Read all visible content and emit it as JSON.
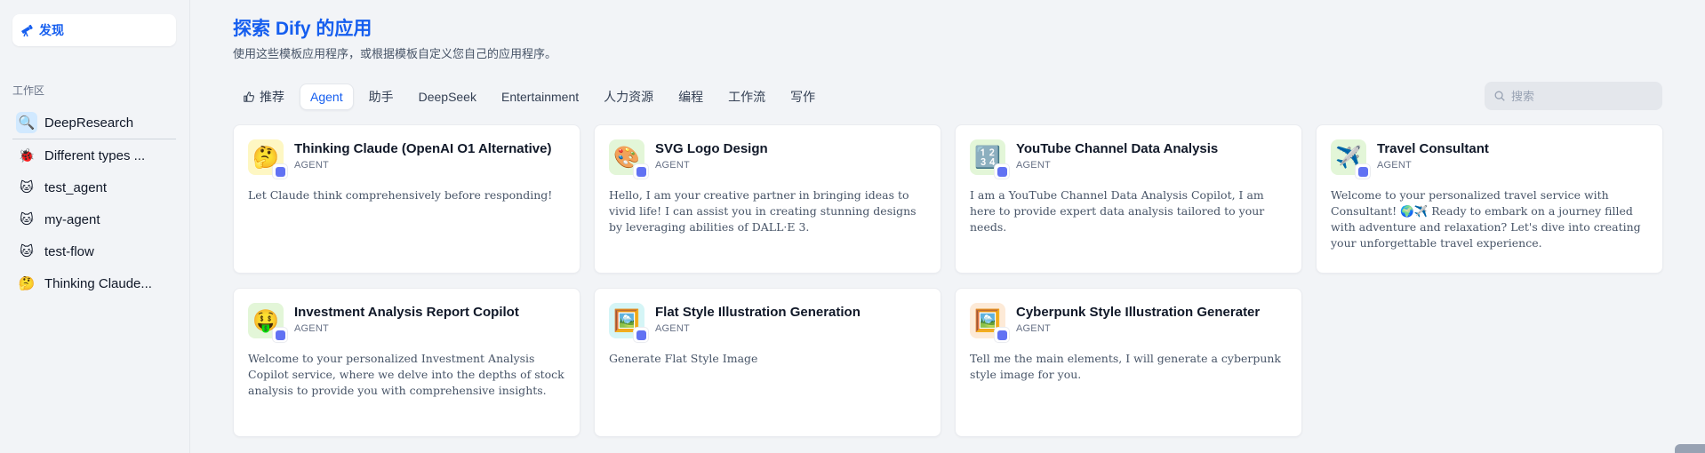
{
  "sidebar": {
    "discover_label": "发现",
    "workspace_label": "工作区",
    "items": [
      {
        "label": "DeepResearch",
        "icon": "🔍",
        "icon_bg": "#d1e9ff"
      },
      {
        "label": "Different types ...",
        "icon": "🐞",
        "icon_bg": "transparent"
      },
      {
        "label": "test_agent",
        "icon": "🐱",
        "icon_bg": "transparent"
      },
      {
        "label": "my-agent",
        "icon": "🐱",
        "icon_bg": "transparent"
      },
      {
        "label": "test-flow",
        "icon": "🐱",
        "icon_bg": "transparent"
      },
      {
        "label": "Thinking Claude...",
        "icon": "🤔",
        "icon_bg": "transparent"
      }
    ]
  },
  "header": {
    "title": "探索 Dify 的应用",
    "subtitle": "使用这些模板应用程序，或根据模板自定义您自己的应用程序。"
  },
  "tabs": [
    {
      "label": "推荐",
      "icon": "thumbs-up-icon"
    },
    {
      "label": "Agent",
      "active": true
    },
    {
      "label": "助手"
    },
    {
      "label": "DeepSeek"
    },
    {
      "label": "Entertainment"
    },
    {
      "label": "人力资源"
    },
    {
      "label": "编程"
    },
    {
      "label": "工作流"
    },
    {
      "label": "写作"
    }
  ],
  "search": {
    "placeholder": "搜索"
  },
  "cards": [
    {
      "title": "Thinking Claude (OpenAI O1 Alternative)",
      "type": "AGENT",
      "icon": "🤔",
      "icon_bg": "#fef7c3",
      "desc": "Let Claude think comprehensively before responding!"
    },
    {
      "title": "SVG Logo Design",
      "type": "AGENT",
      "icon": "🎨",
      "icon_bg": "#e3f6d8",
      "desc": "Hello, I am your creative partner in bringing ideas to vivid life! I can assist you in creating stunning designs by leveraging abilities of DALL·E 3."
    },
    {
      "title": "YouTube Channel Data Analysis",
      "type": "AGENT",
      "icon": "🔢",
      "icon_bg": "#e3f6d8",
      "desc": "I am a YouTube Channel Data Analysis Copilot, I am here to provide expert data analysis tailored to your needs."
    },
    {
      "title": "Travel Consultant",
      "type": "AGENT",
      "icon": "✈️",
      "icon_bg": "#e3f6d8",
      "desc": "Welcome to your personalized travel service with Consultant! 🌍✈️ Ready to embark on a journey filled with adventure and relaxation? Let's dive into creating your unforgettable travel experience."
    },
    {
      "title": "Investment Analysis Report Copilot",
      "type": "AGENT",
      "icon": "🤑",
      "icon_bg": "#e3f6d8",
      "desc": "Welcome to your personalized Investment Analysis Copilot service, where we delve into the depths of stock analysis to provide you with comprehensive insights."
    },
    {
      "title": "Flat Style Illustration Generation",
      "type": "AGENT",
      "icon": "🖼️",
      "icon_bg": "#d5f5f6",
      "desc": "Generate Flat Style Image"
    },
    {
      "title": "Cyberpunk Style Illustration Generater",
      "type": "AGENT",
      "icon": "🖼️",
      "icon_bg": "#fdead7",
      "desc": "Tell me the main elements, I will generate a cyberpunk style image for you."
    }
  ],
  "colors": {
    "accent": "#155eef",
    "agent_badge": "#6172f3"
  }
}
